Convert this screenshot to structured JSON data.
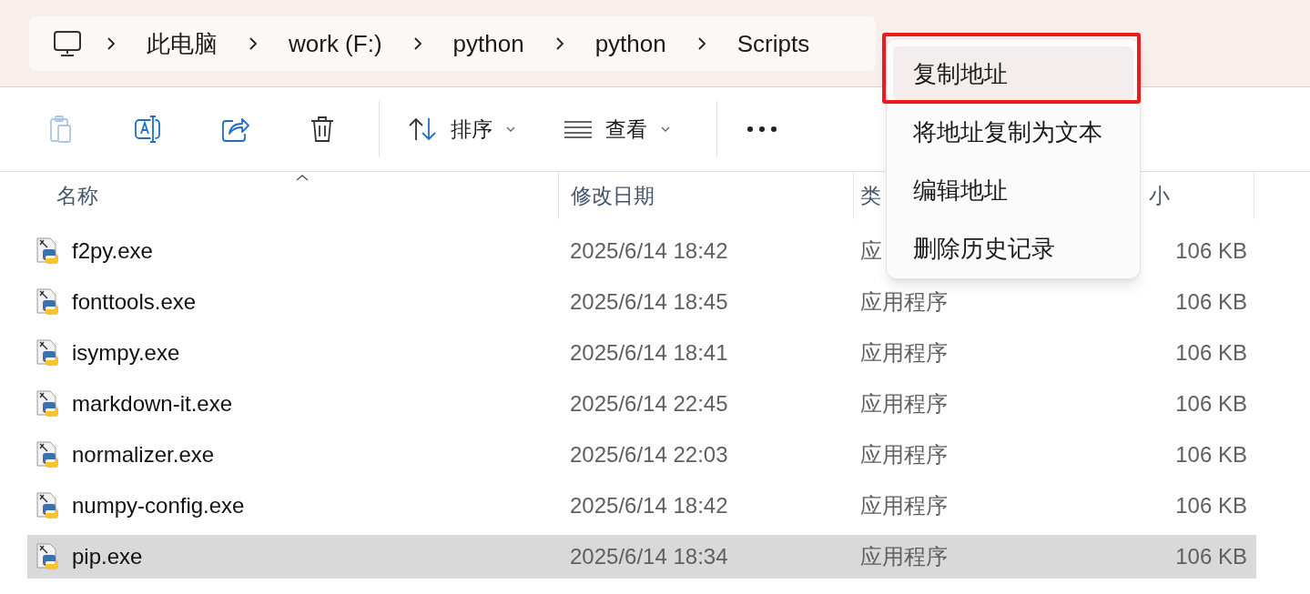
{
  "address_bar": {
    "crumbs": [
      "此电脑",
      "work (F:)",
      "python",
      "python",
      "Scripts"
    ]
  },
  "toolbar": {
    "icon_buttons": [
      {
        "kind": "paste",
        "disabled": true
      },
      {
        "kind": "rename",
        "disabled": false
      },
      {
        "kind": "share",
        "disabled": false
      },
      {
        "kind": "delete",
        "disabled": false
      }
    ],
    "sort": {
      "label": "排序"
    },
    "view": {
      "label": "查看"
    }
  },
  "columns": [
    "名称",
    "修改日期",
    "类",
    "小"
  ],
  "rows": [
    {
      "name": "f2py.exe",
      "modified": "2025/6/14 18:42",
      "type": "应",
      "size": "106 KB",
      "selected": false
    },
    {
      "name": "fonttools.exe",
      "modified": "2025/6/14 18:45",
      "type": "应用程序",
      "size": "106 KB",
      "selected": false
    },
    {
      "name": "isympy.exe",
      "modified": "2025/6/14 18:41",
      "type": "应用程序",
      "size": "106 KB",
      "selected": false
    },
    {
      "name": "markdown-it.exe",
      "modified": "2025/6/14 22:45",
      "type": "应用程序",
      "size": "106 KB",
      "selected": false
    },
    {
      "name": "normalizer.exe",
      "modified": "2025/6/14 22:03",
      "type": "应用程序",
      "size": "106 KB",
      "selected": false
    },
    {
      "name": "numpy-config.exe",
      "modified": "2025/6/14 18:42",
      "type": "应用程序",
      "size": "106 KB",
      "selected": false
    },
    {
      "name": "pip.exe",
      "modified": "2025/6/14 18:34",
      "type": "应用程序",
      "size": "106 KB",
      "selected": true
    }
  ],
  "context_menu": {
    "items": [
      {
        "label": "复制地址",
        "hovered": true,
        "outlined": true
      },
      {
        "label": "将地址复制为文本",
        "hovered": false,
        "outlined": false
      },
      {
        "label": "编辑地址",
        "hovered": false,
        "outlined": false
      },
      {
        "label": "删除历史记录",
        "hovered": false,
        "outlined": false
      }
    ]
  }
}
